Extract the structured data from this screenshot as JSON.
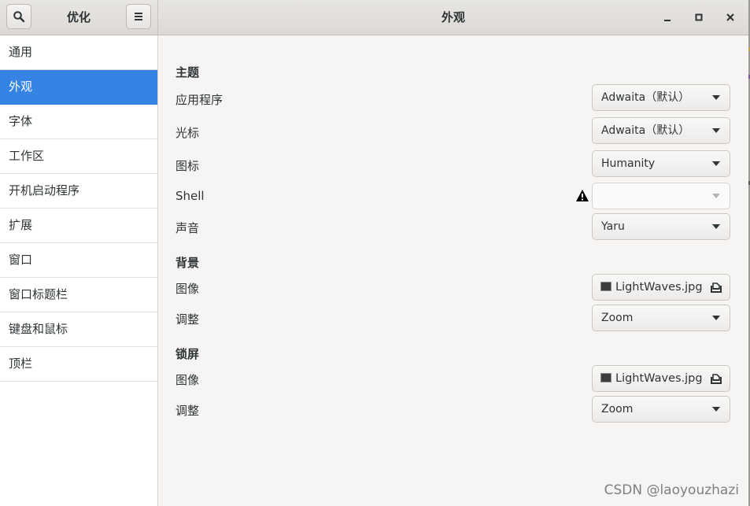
{
  "header": {
    "sidebar_title": "优化",
    "main_title": "外观",
    "search_icon": "search-icon",
    "menu_icon": "hamburger-menu-icon"
  },
  "sidebar": {
    "items": [
      {
        "label": "通用",
        "selected": false
      },
      {
        "label": "外观",
        "selected": true
      },
      {
        "label": "字体",
        "selected": false
      },
      {
        "label": "工作区",
        "selected": false
      },
      {
        "label": "开机启动程序",
        "selected": false
      },
      {
        "label": "扩展",
        "selected": false
      },
      {
        "label": "窗口",
        "selected": false
      },
      {
        "label": "窗口标题栏",
        "selected": false
      },
      {
        "label": "键盘和鼠标",
        "selected": false
      },
      {
        "label": "顶栏",
        "selected": false
      }
    ]
  },
  "themes": {
    "heading": "主题",
    "applications_label": "应用程序",
    "applications_value": "Adwaita（默认）",
    "cursor_label": "光标",
    "cursor_value": "Adwaita（默认）",
    "icons_label": "图标",
    "icons_value": "Humanity",
    "shell_label": "Shell",
    "shell_value": "",
    "sound_label": "声音",
    "sound_value": "Yaru"
  },
  "background": {
    "heading": "背景",
    "image_label": "图像",
    "image_value": "LightWaves.jpg",
    "adjust_label": "调整",
    "adjust_value": "Zoom"
  },
  "lock_screen": {
    "heading": "锁屏",
    "image_label": "图像",
    "image_value": "LightWaves.jpg",
    "adjust_label": "调整",
    "adjust_value": "Zoom"
  },
  "watermark": "CSDN @laoyouzhazi",
  "colors": {
    "accent": "#3584e4",
    "window_bg": "#f6f5f4",
    "sidebar_bg": "#ffffff"
  }
}
